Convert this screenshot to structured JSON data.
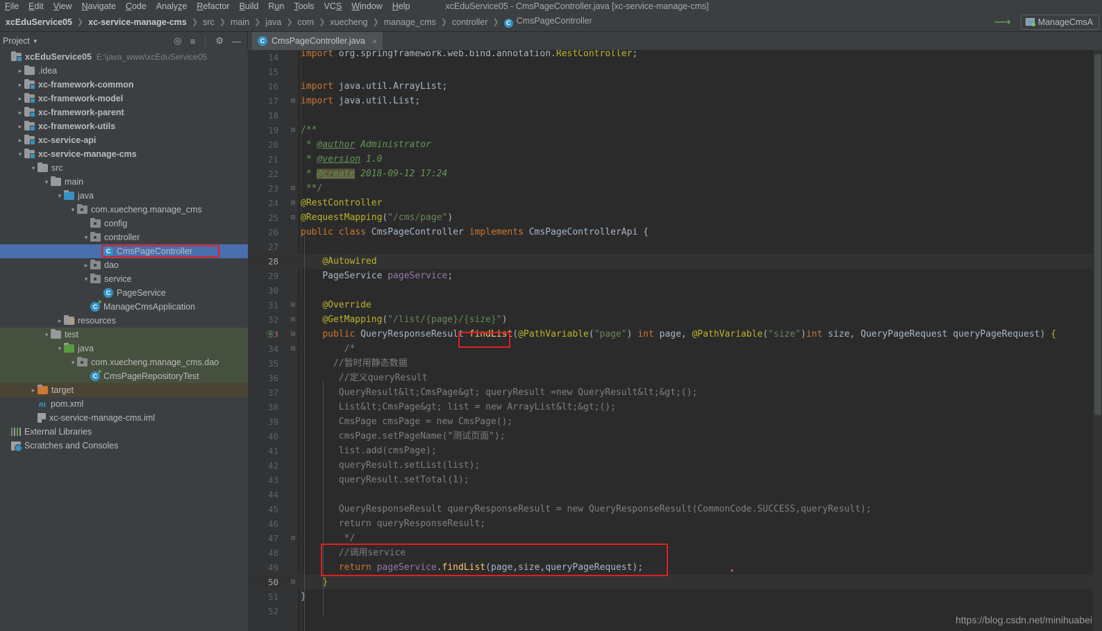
{
  "window": {
    "title": "xcEduService05 - CmsPageController.java [xc-service-manage-cms]"
  },
  "menubar": {
    "items": [
      {
        "label": "File",
        "mnemonic": "F"
      },
      {
        "label": "Edit",
        "mnemonic": "E"
      },
      {
        "label": "View",
        "mnemonic": "V"
      },
      {
        "label": "Navigate",
        "mnemonic": "N"
      },
      {
        "label": "Code",
        "mnemonic": "C"
      },
      {
        "label": "Analyze",
        "mnemonic": "z"
      },
      {
        "label": "Refactor",
        "mnemonic": "R"
      },
      {
        "label": "Build",
        "mnemonic": "B"
      },
      {
        "label": "Run",
        "mnemonic": "u"
      },
      {
        "label": "Tools",
        "mnemonic": "T"
      },
      {
        "label": "VCS",
        "mnemonic": "S"
      },
      {
        "label": "Window",
        "mnemonic": "W"
      },
      {
        "label": "Help",
        "mnemonic": "H"
      }
    ]
  },
  "navbar": {
    "crumbs": [
      "xcEduService05",
      "xc-service-manage-cms",
      "src",
      "main",
      "java",
      "com",
      "xuecheng",
      "manage_cms",
      "controller",
      "CmsPageController"
    ],
    "class_icon_letter": "C",
    "run_config": "ManageCmsA",
    "run_config_full": "ManageCmsApplication"
  },
  "project_panel": {
    "title": "Project",
    "tree": [
      {
        "label": "xcEduService05",
        "sub": "E:\\java_www\\xcEduService05",
        "indent": 0,
        "arrow": "",
        "icon": "module-folder",
        "bold": true
      },
      {
        "label": ".idea",
        "sub": "",
        "indent": 1,
        "arrow": "›",
        "icon": "folder",
        "bold": false
      },
      {
        "label": "xc-framework-common",
        "sub": "",
        "indent": 1,
        "arrow": "›",
        "icon": "module-folder",
        "bold": true
      },
      {
        "label": "xc-framework-model",
        "sub": "",
        "indent": 1,
        "arrow": "›",
        "icon": "module-folder",
        "bold": true
      },
      {
        "label": "xc-framework-parent",
        "sub": "",
        "indent": 1,
        "arrow": "›",
        "icon": "module-folder",
        "bold": true
      },
      {
        "label": "xc-framework-utils",
        "sub": "",
        "indent": 1,
        "arrow": "›",
        "icon": "module-folder",
        "bold": true
      },
      {
        "label": "xc-service-api",
        "sub": "",
        "indent": 1,
        "arrow": "›",
        "icon": "module-folder",
        "bold": true
      },
      {
        "label": "xc-service-manage-cms",
        "sub": "",
        "indent": 1,
        "arrow": "∨",
        "icon": "module-folder",
        "bold": true
      },
      {
        "label": "src",
        "sub": "",
        "indent": 2,
        "arrow": "∨",
        "icon": "folder",
        "bold": false
      },
      {
        "label": "main",
        "sub": "",
        "indent": 3,
        "arrow": "∨",
        "icon": "folder",
        "bold": false
      },
      {
        "label": "java",
        "sub": "",
        "indent": 4,
        "arrow": "∨",
        "icon": "folder-blue",
        "bold": false
      },
      {
        "label": "com.xuecheng.manage_cms",
        "sub": "",
        "indent": 5,
        "arrow": "∨",
        "icon": "package",
        "bold": false
      },
      {
        "label": "config",
        "sub": "",
        "indent": 6,
        "arrow": "",
        "icon": "package",
        "bold": false
      },
      {
        "label": "controller",
        "sub": "",
        "indent": 6,
        "arrow": "∨",
        "icon": "package",
        "bold": false
      },
      {
        "label": "CmsPageController",
        "sub": "",
        "indent": 7,
        "arrow": "",
        "icon": "class",
        "bold": false,
        "selected": true,
        "highlight": true
      },
      {
        "label": "dao",
        "sub": "",
        "indent": 6,
        "arrow": "›",
        "icon": "package",
        "bold": false
      },
      {
        "label": "service",
        "sub": "",
        "indent": 6,
        "arrow": "∨",
        "icon": "package",
        "bold": false
      },
      {
        "label": "PageService",
        "sub": "",
        "indent": 7,
        "arrow": "",
        "icon": "class",
        "bold": false
      },
      {
        "label": "ManageCmsApplication",
        "sub": "",
        "indent": 6,
        "arrow": "",
        "icon": "class-run",
        "bold": false
      },
      {
        "label": "resources",
        "sub": "",
        "indent": 4,
        "arrow": "›",
        "icon": "resources-folder",
        "bold": false
      },
      {
        "label": "test",
        "sub": "",
        "indent": 3,
        "arrow": "∨",
        "icon": "folder",
        "bold": false,
        "rowbg": "test"
      },
      {
        "label": "java",
        "sub": "",
        "indent": 4,
        "arrow": "∨",
        "icon": "folder-green",
        "bold": false,
        "rowbg": "test"
      },
      {
        "label": "com.xuecheng.manage_cms.dao",
        "sub": "",
        "indent": 5,
        "arrow": "∨",
        "icon": "package",
        "bold": false,
        "rowbg": "test"
      },
      {
        "label": "CmsPageRepositoryTest",
        "sub": "",
        "indent": 6,
        "arrow": "",
        "icon": "class-run",
        "bold": false,
        "rowbg": "test"
      },
      {
        "label": "target",
        "sub": "",
        "indent": 2,
        "arrow": "›",
        "icon": "folder-orange",
        "bold": false,
        "rowbg": "target"
      },
      {
        "label": "pom.xml",
        "sub": "",
        "indent": 2,
        "arrow": "",
        "icon": "maven",
        "bold": false
      },
      {
        "label": "xc-service-manage-cms.iml",
        "sub": "",
        "indent": 2,
        "arrow": "",
        "icon": "iml",
        "bold": false
      },
      {
        "label": "External Libraries",
        "sub": "",
        "indent": 0,
        "arrow": "",
        "icon": "extlib",
        "bold": false
      },
      {
        "label": "Scratches and Consoles",
        "sub": "",
        "indent": 0,
        "arrow": "",
        "icon": "scratch",
        "bold": false
      }
    ]
  },
  "editor": {
    "tab": {
      "label": "CmsPageController.java",
      "icon_letter": "C",
      "close": "×"
    },
    "first_visible_line": 14,
    "lines": [
      {
        "n": 14,
        "clipped": true
      },
      {
        "n": 15
      },
      {
        "n": 16
      },
      {
        "n": 17,
        "fold": "⊖"
      },
      {
        "n": 18
      },
      {
        "n": 19,
        "fold": "⊖"
      },
      {
        "n": 20
      },
      {
        "n": 21
      },
      {
        "n": 22
      },
      {
        "n": 23,
        "fold": "⊖"
      },
      {
        "n": 24,
        "fold": "⊖"
      },
      {
        "n": 25,
        "fold": "⊖"
      },
      {
        "n": 26
      },
      {
        "n": 27
      },
      {
        "n": 28,
        "caret": true
      },
      {
        "n": 29
      },
      {
        "n": 30
      },
      {
        "n": 31,
        "fold": "⊖"
      },
      {
        "n": 32,
        "fold": "⊖"
      },
      {
        "n": 33,
        "fold": "⊖",
        "override": true
      },
      {
        "n": 34,
        "fold": "⊖"
      },
      {
        "n": 35
      },
      {
        "n": 36
      },
      {
        "n": 37
      },
      {
        "n": 38
      },
      {
        "n": 39
      },
      {
        "n": 40
      },
      {
        "n": 41
      },
      {
        "n": 42
      },
      {
        "n": 43
      },
      {
        "n": 44
      },
      {
        "n": 45
      },
      {
        "n": 46
      },
      {
        "n": 47,
        "fold": "⊖"
      },
      {
        "n": 48
      },
      {
        "n": 49
      },
      {
        "n": 50,
        "fold": "⊖",
        "caret": true
      },
      {
        "n": 51
      },
      {
        "n": 52
      }
    ],
    "source_text": {
      "l14": "import org.springframework.web.bind.annotation.RestController;",
      "l16": "import java.util.ArrayList;",
      "l17": "import java.util.List;",
      "l19": "/**",
      "l20": " * @author Administrator",
      "l21": " * @version 1.0",
      "l22": " * @create 2018-09-12 17:24",
      "l23": " **/",
      "l24": "@RestController",
      "l25": "@RequestMapping(\"/cms/page\")",
      "l26": "public class CmsPageController implements CmsPageControllerApi {",
      "l28": "    @Autowired",
      "l29": "    PageService pageService;",
      "l31": "    @Override",
      "l32": "    @GetMapping(\"/list/{page}/{size}\")",
      "l33": "    public QueryResponseResult findList(@PathVariable(\"page\") int page, @PathVariable(\"size\")int size, QueryPageRequest queryPageRequest) {",
      "l34": "        /*",
      "l35": "      //暂时用静态数据",
      "l36": "       //定义queryResult",
      "l37": "       QueryResult<CmsPage> queryResult =new QueryResult<>();",
      "l38": "       List<CmsPage> list = new ArrayList<>();",
      "l39": "       CmsPage cmsPage = new CmsPage();",
      "l40": "       cmsPage.setPageName(\"测试页面\");",
      "l41": "       list.add(cmsPage);",
      "l42": "       queryResult.setList(list);",
      "l43": "       queryResult.setTotal(1);",
      "l45": "       QueryResponseResult queryResponseResult = new QueryResponseResult(CommonCode.SUCCESS,queryResult);",
      "l46": "       return queryResponseResult;",
      "l47": "        */",
      "l48": "       //调用service",
      "l49": "       return pageService.findList(page,size,queryPageRequest);",
      "l50": "    }",
      "l51": "}"
    }
  },
  "annotations": {
    "highlight_color": "#e02020",
    "boxes": [
      {
        "name": "tree-selected-class-box"
      },
      {
        "name": "findlist-method-box"
      },
      {
        "name": "service-call-box"
      }
    ]
  },
  "watermark": "https://blog.csdn.net/minihuabei",
  "colors": {
    "editor_bg": "#2b2b2b",
    "panel_bg": "#3c3f41",
    "gutter_bg": "#313335",
    "selection_blue": "#4b6eaf",
    "test_green_bg": "#46503f",
    "target_bg": "#4a4434",
    "keyword": "#cc7832",
    "annotation": "#bbb529",
    "string": "#6a8759",
    "number": "#6897bb",
    "comment": "#808080",
    "javadoc": "#629755",
    "identifier": "#a9b7c6",
    "field": "#9876aa",
    "method": "#ffc66d"
  }
}
